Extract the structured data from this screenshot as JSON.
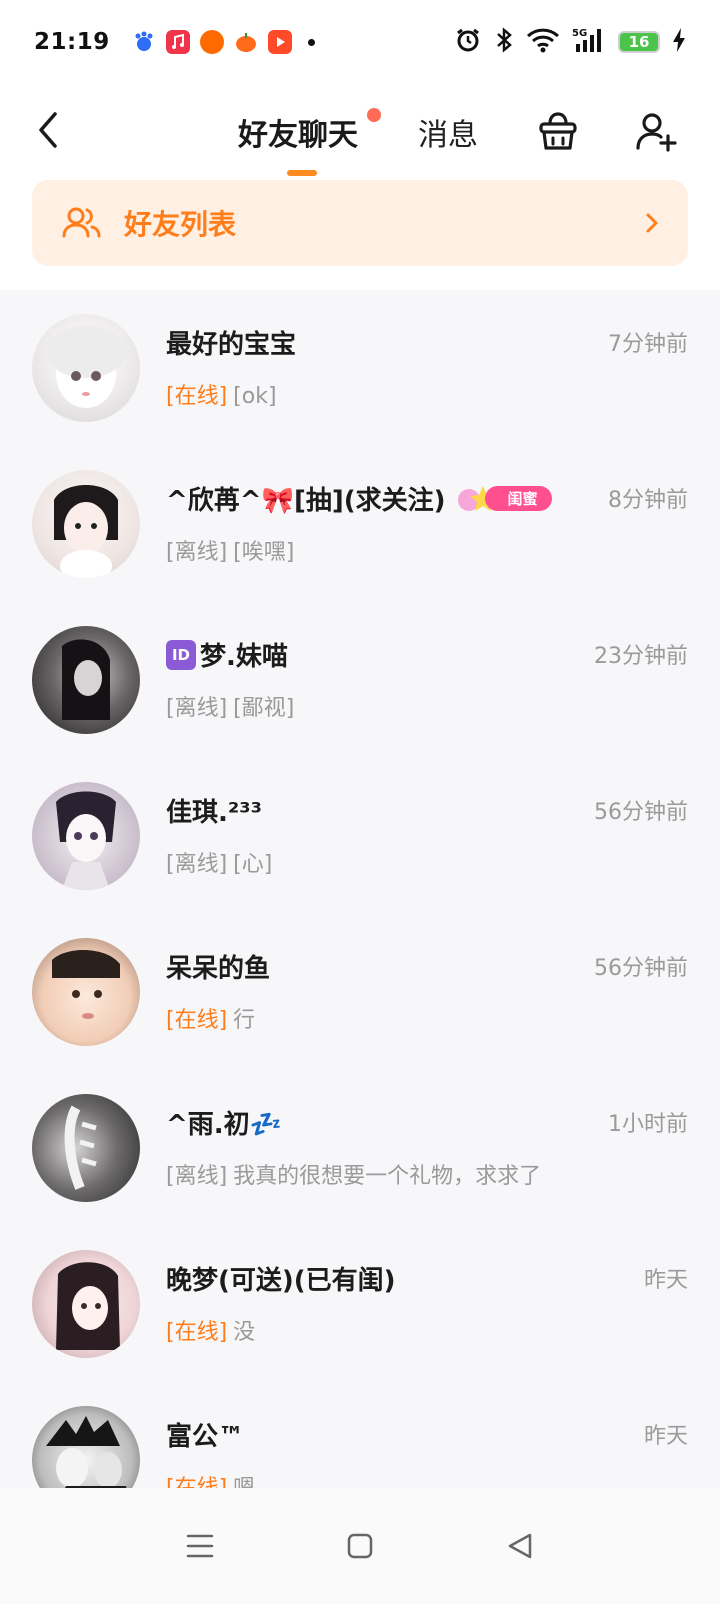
{
  "status_bar": {
    "time": "21:19",
    "battery": "16",
    "network": "5G"
  },
  "header": {
    "tabs": [
      {
        "label": "好友聊天",
        "active": true,
        "has_dot": true
      },
      {
        "label": "消息",
        "active": false
      }
    ],
    "accent_color": "#ff8a20"
  },
  "banner": {
    "label": "好友列表"
  },
  "chats": [
    {
      "name": "最好的宝宝",
      "time": "7分钟前",
      "status": "[在线]",
      "online": true,
      "preview": "[ok]"
    },
    {
      "name": "^欣苒^🎀[抽](求关注)",
      "time": "8分钟前",
      "status": "[离线]",
      "online": false,
      "preview": "[唉嘿]",
      "badge": "闺蜜"
    },
    {
      "name": "梦.妹喵",
      "time": "23分钟前",
      "status": "[离线]",
      "online": false,
      "preview": "[鄙视]",
      "prefix_icon": "ID"
    },
    {
      "name": "佳琪.²³³",
      "time": "56分钟前",
      "status": "[离线]",
      "online": false,
      "preview": "[心]"
    },
    {
      "name": "呆呆的鱼",
      "time": "56分钟前",
      "status": "[在线]",
      "online": true,
      "preview": "行"
    },
    {
      "name": "^雨.初💤",
      "time": "1小时前",
      "status": "[离线]",
      "online": false,
      "preview": "我真的很想要一个礼物，求求了"
    },
    {
      "name": "晚梦(可送)(已有闺)",
      "time": "昨天",
      "status": "[在线]",
      "online": true,
      "preview": "没"
    },
    {
      "name": "富公™",
      "time": "昨天",
      "status": "[在线]",
      "online": true,
      "preview": "嗯"
    }
  ]
}
